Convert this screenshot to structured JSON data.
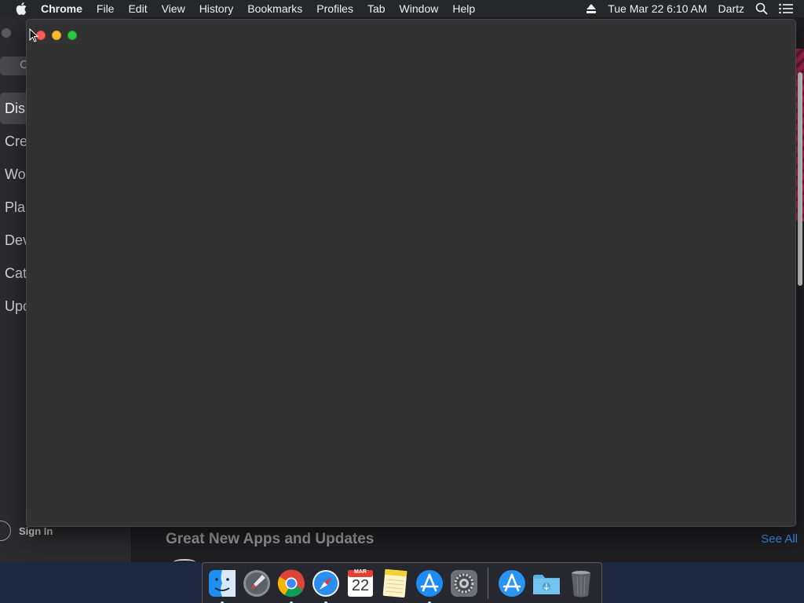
{
  "menubar": {
    "app_name": "Chrome",
    "items": [
      "File",
      "Edit",
      "View",
      "History",
      "Bookmarks",
      "Profiles",
      "Tab",
      "Window",
      "Help"
    ],
    "datetime": "Tue Mar 22  6:10 AM",
    "user": "Dartz"
  },
  "appstore": {
    "sidebar": {
      "nav_items": [
        "Dis",
        "Cre",
        "Wo",
        "Pla",
        "Dev",
        "Cat",
        "Upd"
      ],
      "active_index": 0,
      "sign_in": "Sign In"
    },
    "content": {
      "section_title": "Great New Apps and Updates",
      "see_all": "See All"
    }
  },
  "dock": {
    "apps": [
      {
        "name": "finder-icon",
        "running": true
      },
      {
        "name": "launchpad-icon",
        "running": false
      },
      {
        "name": "chrome-icon",
        "running": true
      },
      {
        "name": "safari-icon",
        "running": true
      },
      {
        "name": "calendar-icon",
        "running": false,
        "month": "MAR",
        "day": "22"
      },
      {
        "name": "notes-icon",
        "running": false
      },
      {
        "name": "app-store-icon",
        "running": true
      },
      {
        "name": "system-preferences-icon",
        "running": false
      }
    ],
    "others": [
      {
        "name": "app-store-downloads-icon"
      },
      {
        "name": "downloads-folder-icon"
      },
      {
        "name": "trash-icon"
      }
    ]
  },
  "colors": {
    "traffic_close": "#fc5f57",
    "traffic_minimize": "#fdbc2e",
    "traffic_zoom": "#28c840",
    "link": "#3c8df5"
  }
}
